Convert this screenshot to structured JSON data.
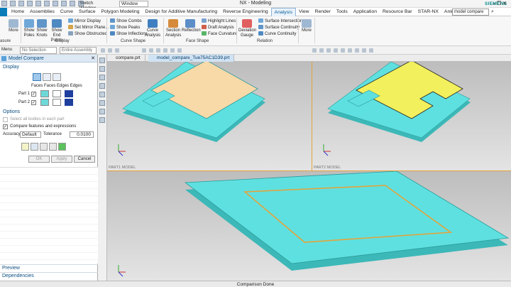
{
  "window": {
    "title": "NX - Modeling",
    "switch_window": "Switch Window",
    "window_menu": "Window",
    "brand": "SIEMENS"
  },
  "menu": {
    "tabs": [
      "Home",
      "Assemblies",
      "Curve",
      "Surface",
      "Polygon Modeling",
      "Design for Additive Manufacturing",
      "Reverse Engineering",
      "Analysis",
      "View",
      "Render",
      "Tools",
      "Application",
      "Resource Bar",
      "STAR-NX",
      "Animation Designer"
    ],
    "active_tab": "Analysis",
    "search_value": "model compare"
  },
  "ribbon": {
    "more_left": "More",
    "show_poles": "Show Poles",
    "show_knots": "Show Knots",
    "show_end_points": "Show End Points",
    "mirror_display": "Mirror Display",
    "set_mirror_plane": "Set Mirror Plane...",
    "show_obstructed": "Show Obstructed",
    "display_group": "Display",
    "show_combs": "Show Combs",
    "show_peaks": "Show Peaks",
    "show_inflections": "Show Inflections",
    "curve_analysis": "Curve Analysis",
    "curve_shape_group": "Curve Shape",
    "section_analysis": "Section Analysis",
    "reflection": "Reflection",
    "highlight_lines": "Highlight Lines",
    "draft_analysis": "Draft Analysis",
    "face_curvature": "Face Curvature",
    "face_shape_group": "Face Shape",
    "deviation_gauge": "Deviation Gauge",
    "surface_intersection": "Surface Intersection",
    "surface_continuity": "Surface Continuity",
    "curve_continuity": "Curve Continuity",
    "relation_group": "Relation",
    "more_right": "More",
    "measure_group_cut": "asure"
  },
  "selection_bar": {
    "menu": "Menu",
    "filter": "No Selection Filter",
    "scope": "Entire Assembly"
  },
  "panel": {
    "title": "Model Compare",
    "display_section": "Display",
    "col_headers": "Faces Faces Edges Edges",
    "part1": "Part 1",
    "part2": "Part 2",
    "options_section": "Options",
    "select_all_bodies": "Select all bodies in each part",
    "compare_features": "Compare features and expressions",
    "accuracy_label": "Accuracy",
    "accuracy_value": "Default",
    "tolerance_label": "Tolerance",
    "tolerance_value": "0.0100",
    "ok": "OK",
    "apply": "Apply",
    "cancel": "Cancel",
    "preview": "Preview",
    "dependencies": "Dependencies",
    "colors": {
      "part1_faces_a": "#6dd9d9",
      "part1_faces_b": "#ffffff",
      "part1_edges": "#1e3f9e",
      "part2_faces_a": "#6dd9d9",
      "part2_faces_b": "#ffffff",
      "part2_edges": "#1e3f9e"
    }
  },
  "graphics": {
    "tab1": "compare.prt",
    "tab2": "model_compare_Tue75AC1D39.prt",
    "vp1_label": "PART1 MODEL",
    "vp2_label": "PART2 MODEL",
    "vp3_label": "COMBINED",
    "part_color": "#5fe0e0",
    "face_color_1": "#f8d9a8",
    "face_color_2": "#f2f05c",
    "highlight_color": "#e3a33a"
  },
  "status": "Comparison Done"
}
